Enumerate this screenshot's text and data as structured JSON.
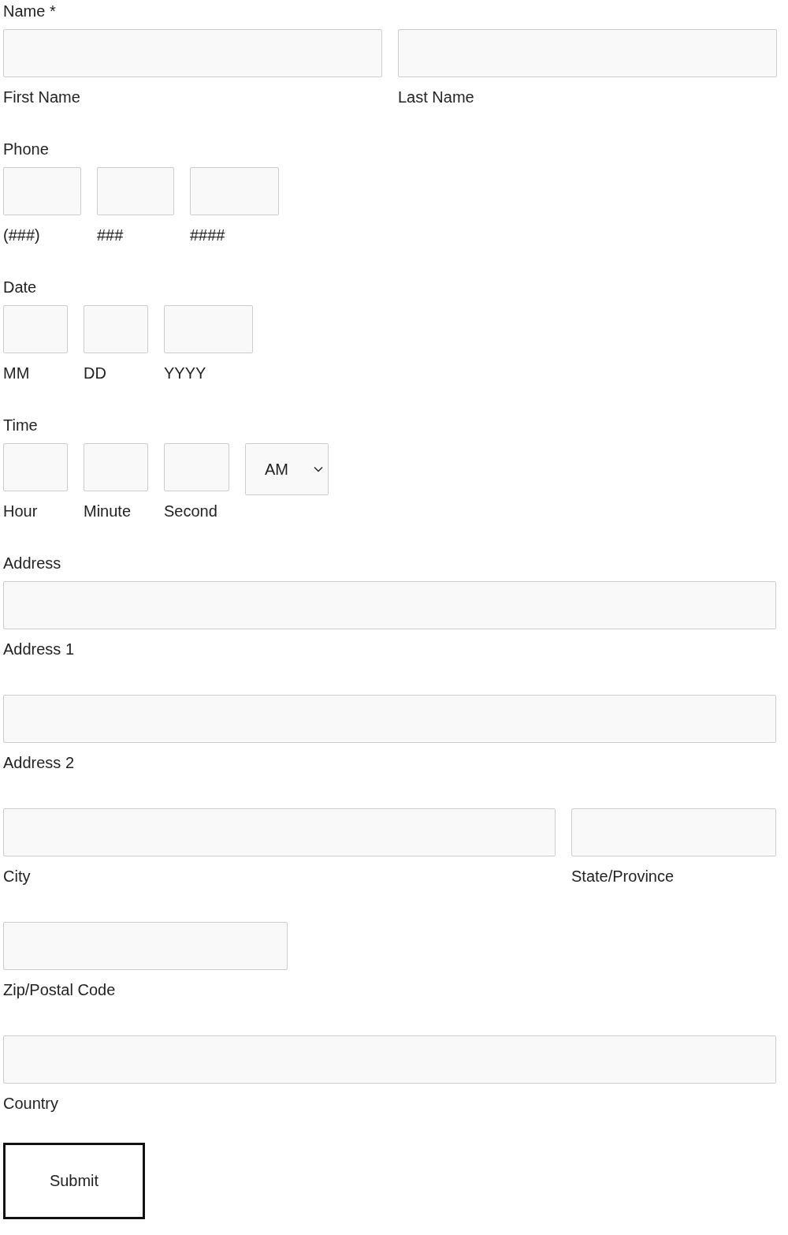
{
  "sections": [
    {
      "label": "Name *",
      "rows": [
        [
          {
            "kind": "text",
            "caption": "First Name"
          },
          {
            "kind": "text",
            "caption": "Last Name"
          }
        ]
      ]
    },
    {
      "label": "Phone",
      "rows": [
        [
          {
            "kind": "text",
            "caption": "(###)"
          },
          {
            "kind": "text",
            "caption": "###"
          },
          {
            "kind": "text",
            "caption": "####"
          }
        ]
      ]
    },
    {
      "label": "Date",
      "rows": [
        [
          {
            "kind": "text",
            "caption": "MM"
          },
          {
            "kind": "text",
            "caption": "DD"
          },
          {
            "kind": "text",
            "caption": "YYYY"
          }
        ]
      ]
    },
    {
      "label": "Time",
      "rows": [
        [
          {
            "kind": "text",
            "caption": "Hour"
          },
          {
            "kind": "text",
            "caption": "Minute"
          },
          {
            "kind": "text",
            "caption": "Second"
          },
          {
            "kind": "select",
            "value": "AM"
          }
        ]
      ]
    },
    {
      "label": "Address",
      "rows": [
        [
          {
            "kind": "text",
            "caption": "Address 1"
          }
        ],
        [
          {
            "kind": "text",
            "caption": "Address 2"
          }
        ],
        [
          {
            "kind": "text",
            "caption": "City"
          },
          {
            "kind": "text",
            "caption": "State/Province"
          }
        ],
        [
          {
            "kind": "text",
            "caption": "Zip/Postal Code"
          }
        ],
        [
          {
            "kind": "text",
            "caption": "Country"
          }
        ]
      ]
    }
  ],
  "submit": {
    "label": "Submit"
  }
}
